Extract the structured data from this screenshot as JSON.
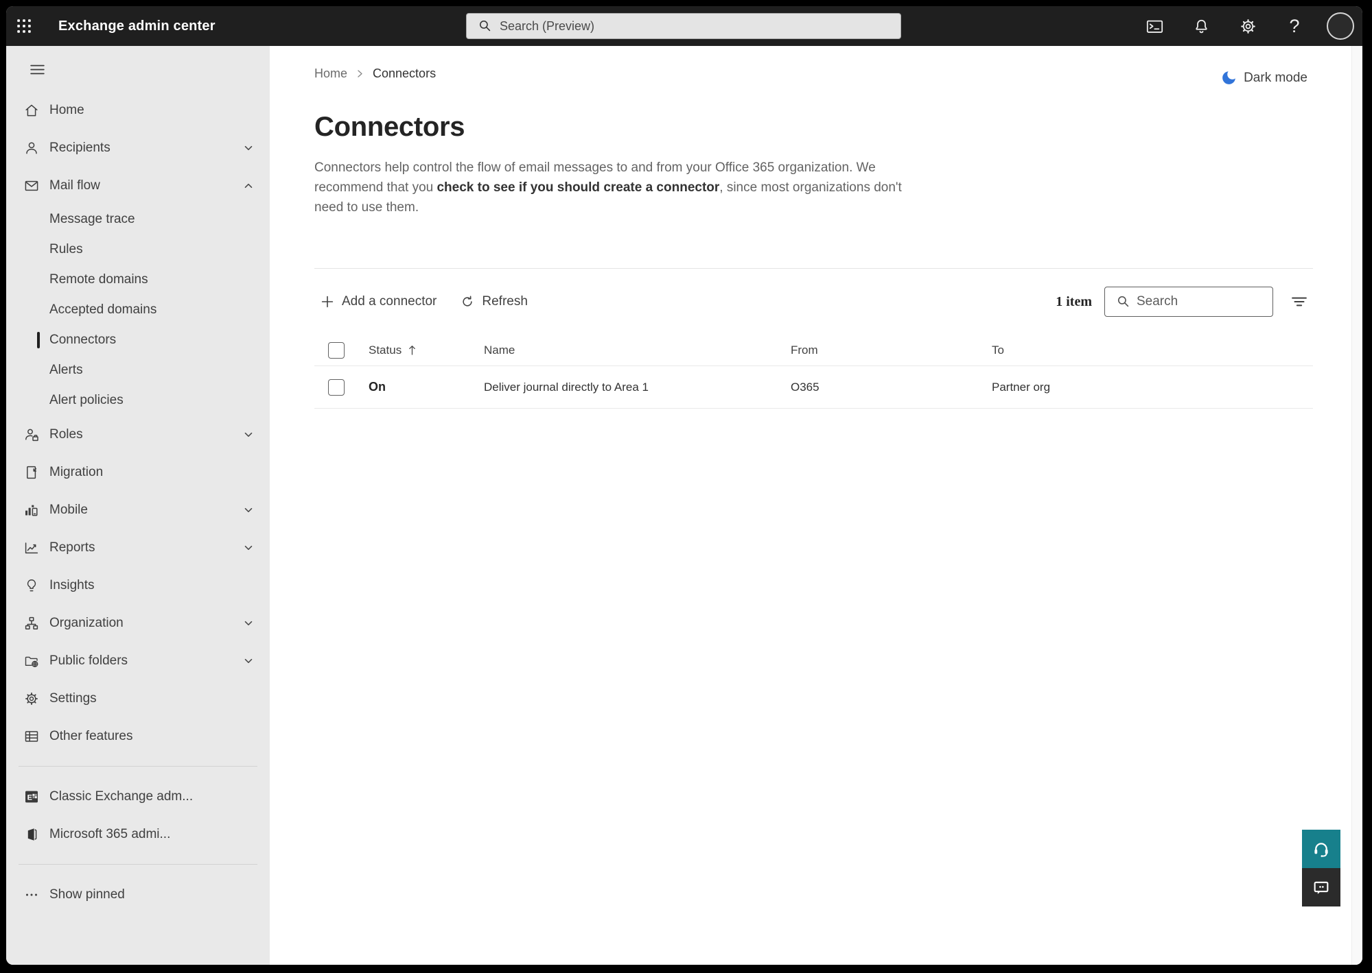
{
  "topbar": {
    "app_title": "Exchange admin center",
    "search_placeholder": "Search (Preview)",
    "icons": [
      "app-launcher-icon",
      "terminal-icon",
      "bell-icon",
      "gear-icon",
      "help-icon",
      "avatar"
    ],
    "help_glyph": "?"
  },
  "sidebar": {
    "items": [
      {
        "label": "Home",
        "icon": "home-icon"
      },
      {
        "label": "Recipients",
        "icon": "person-icon",
        "chevron": "down"
      },
      {
        "label": "Mail flow",
        "icon": "mail-icon",
        "chevron": "up",
        "expanded": true
      },
      {
        "label": "Message trace",
        "sub": true
      },
      {
        "label": "Rules",
        "sub": true
      },
      {
        "label": "Remote domains",
        "sub": true
      },
      {
        "label": "Accepted domains",
        "sub": true
      },
      {
        "label": "Connectors",
        "sub": true,
        "selected": true
      },
      {
        "label": "Alerts",
        "sub": true
      },
      {
        "label": "Alert policies",
        "sub": true
      },
      {
        "label": "Roles",
        "icon": "roles-icon",
        "chevron": "down"
      },
      {
        "label": "Migration",
        "icon": "migration-icon"
      },
      {
        "label": "Mobile",
        "icon": "mobile-icon",
        "chevron": "down"
      },
      {
        "label": "Reports",
        "icon": "reports-icon",
        "chevron": "down"
      },
      {
        "label": "Insights",
        "icon": "lightbulb-icon"
      },
      {
        "label": "Organization",
        "icon": "org-tree-icon",
        "chevron": "down"
      },
      {
        "label": "Public folders",
        "icon": "folder-globe-icon",
        "chevron": "down"
      },
      {
        "label": "Settings",
        "icon": "gear-icon"
      },
      {
        "label": "Other features",
        "icon": "table-icon"
      }
    ],
    "footer_items": [
      {
        "label": "Classic Exchange adm...",
        "icon": "exchange-logo-icon"
      },
      {
        "label": "Microsoft 365 admi...",
        "icon": "microsoft365-logo-icon"
      }
    ],
    "show_pinned_label": "Show pinned"
  },
  "breadcrumb": {
    "items": [
      "Home",
      "Connectors"
    ]
  },
  "darkmode_label": "Dark mode",
  "page": {
    "title": "Connectors",
    "description_1": "Connectors help control the flow of email messages to and from your Office 365 organization. We recommend that you ",
    "description_link": "check to see if you should create a connector",
    "description_2": ", since most organizations don't need to use them."
  },
  "toolbar": {
    "add_label": "Add a connector",
    "refresh_label": "Refresh",
    "item_count": "1 item",
    "search_placeholder": "Search"
  },
  "table": {
    "columns": [
      "Status",
      "Name",
      "From",
      "To"
    ],
    "sort_column": "Status",
    "sort_direction": "ascending",
    "rows": [
      {
        "status": "On",
        "name": "Deliver journal directly to Area 1",
        "from": "O365",
        "to": "Partner org"
      }
    ]
  },
  "colors": {
    "topbar_bg": "#1f1f1f",
    "sidebar_bg": "#e9e9e9",
    "accent_teal": "#17808c",
    "moon_blue": "#3174d9",
    "selected_indicator": "#1f1f1f"
  }
}
